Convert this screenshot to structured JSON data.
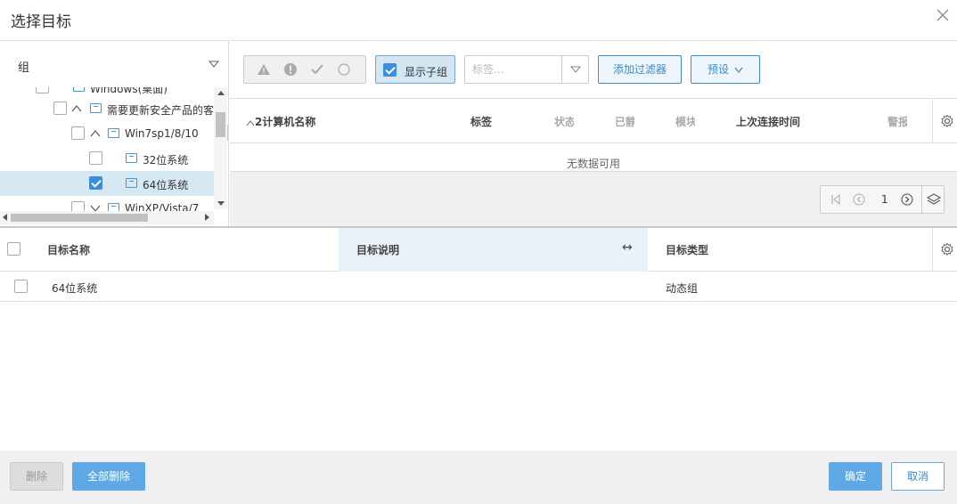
{
  "dialog": {
    "title": "选择目标",
    "close_icon": "close-icon"
  },
  "tree_panel": {
    "group_label": "组",
    "items": [
      {
        "label": "Windows(桌面)",
        "checked": false,
        "expanded": true
      },
      {
        "label": "需要更新安全产品的客",
        "checked": false,
        "expanded": true
      },
      {
        "label": "Win7sp1/8/10",
        "checked": false,
        "expanded": true
      },
      {
        "label": "32位系统",
        "checked": false
      },
      {
        "label": "64位系统",
        "checked": true,
        "selected": true
      },
      {
        "label": "WinXP/Vista/7",
        "checked": false,
        "expanded": false
      }
    ]
  },
  "toolbar": {
    "status_icons": [
      "warning-icon",
      "error-icon",
      "check-icon",
      "circle-icon"
    ],
    "show_subgroups_label": "显示子组",
    "show_subgroups_checked": true,
    "tag_placeholder": "标签...",
    "add_filter_label": "添加过滤器",
    "preset_label": "预设"
  },
  "computer_table": {
    "columns": [
      "2计算机名称",
      "标签",
      "状态",
      "已静",
      "模块",
      "上次连接时间",
      "警报"
    ],
    "sort_column": "2计算机名称",
    "empty_text": "无数据可用",
    "page": "1"
  },
  "target_table": {
    "columns": {
      "name": "目标名称",
      "description": "目标说明",
      "type": "目标类型"
    },
    "rows": [
      {
        "name": "64位系统",
        "description": "",
        "type": "动态组",
        "checked": false
      }
    ]
  },
  "footer": {
    "delete_label": "删除",
    "delete_all_label": "全部删除",
    "ok_label": "确定",
    "cancel_label": "取消"
  },
  "colors": {
    "accent": "#3b8ad0",
    "primary_button": "#5fa8e6",
    "selected_row": "#d6e8f1",
    "highlight_column": "#e8f3f8"
  }
}
